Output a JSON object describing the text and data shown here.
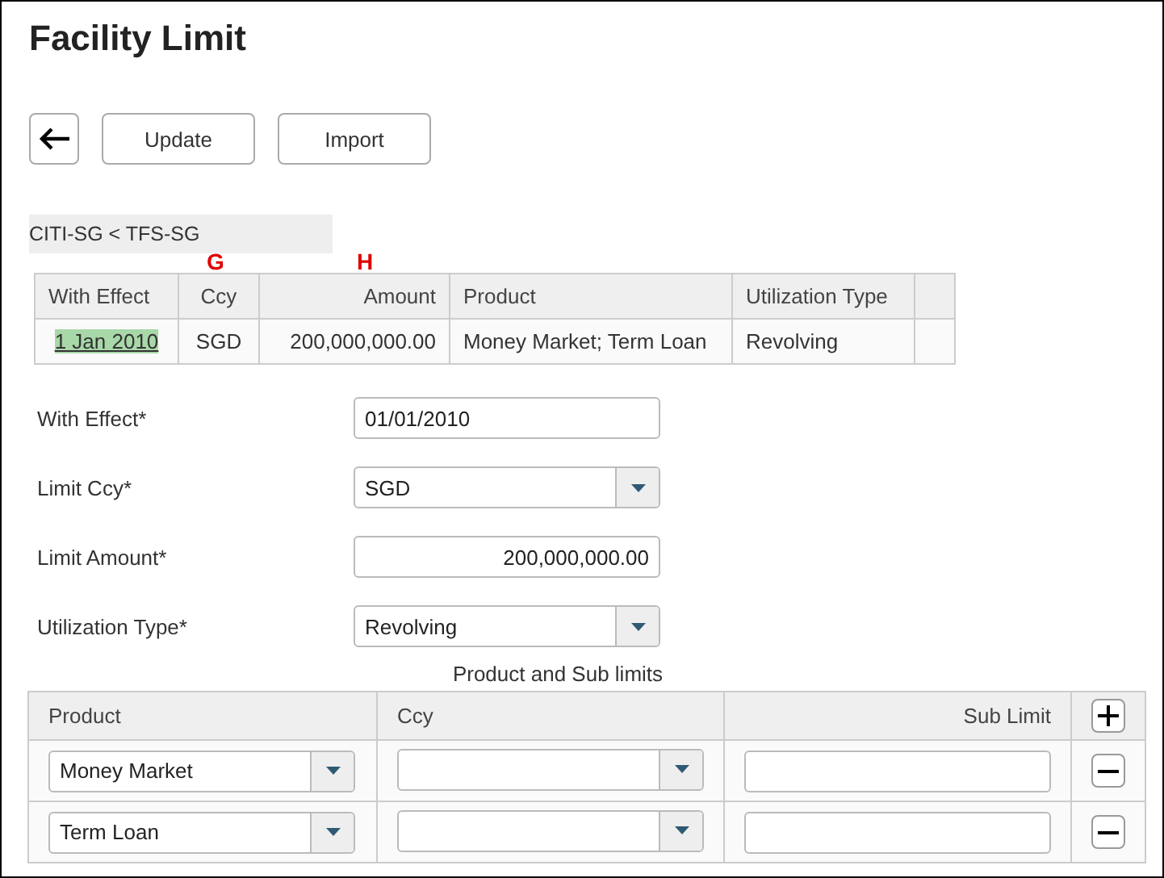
{
  "page": {
    "title": "Facility Limit"
  },
  "toolbar": {
    "buttons": [
      "Update",
      "Import"
    ]
  },
  "breadcrumb": "CITI-SG < TFS-SG",
  "annotations": [
    {
      "text": "G"
    },
    {
      "text": "H"
    }
  ],
  "summary_table": {
    "columns": [
      "With Effect",
      "Ccy",
      "Amount",
      "Product",
      "Utilization Type"
    ],
    "rows": [
      {
        "cells": [
          "1 Jan 2010",
          "SGD",
          "200,000,000.00",
          "Money Market; Term Loan",
          "Revolving"
        ],
        "highlighted": true
      }
    ]
  },
  "form": [
    {
      "label": "With Effect*",
      "kind": "text",
      "value": "01/01/2010"
    },
    {
      "label": "Limit Ccy*",
      "kind": "select",
      "value": "SGD"
    },
    {
      "label": "Limit Amount*",
      "kind": "amount",
      "value": "200,000,000.00"
    },
    {
      "label": "Utilization Type*",
      "kind": "select",
      "value": "Revolving"
    }
  ],
  "sub_limits": {
    "title": "Product and Sub limits",
    "columns": [
      "Product",
      "Ccy",
      "Sub Limit"
    ],
    "rows": [
      {
        "product": "Money Market"
      },
      {
        "product": "Term Loan"
      }
    ]
  }
}
